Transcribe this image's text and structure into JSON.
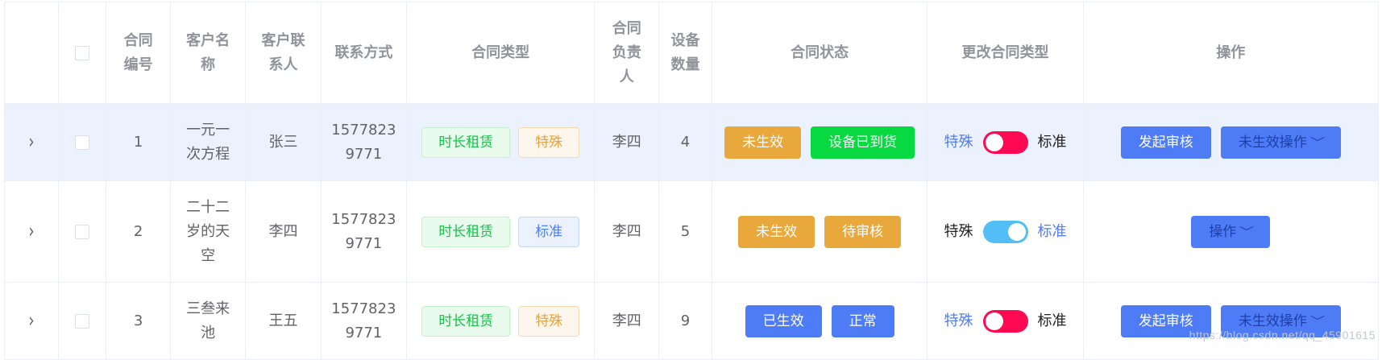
{
  "headers": {
    "contract_no": "合同编号",
    "customer_name": "客户名称",
    "customer_contact": "客户联系人",
    "phone": "联系方式",
    "contract_type": "合同类型",
    "owner": "合同负责人",
    "device_count": "设备数量",
    "contract_status": "合同状态",
    "change_type": "更改合同类型",
    "actions": "操作"
  },
  "rows": [
    {
      "no": "1",
      "customer": "一元一次方程",
      "contact": "张三",
      "phone": "15778239771",
      "type_tag": "时长租赁",
      "sub_tag": "特殊",
      "owner": "李四",
      "devices": "4",
      "status1": "未生效",
      "status2": "设备已到货",
      "switch_left": "特殊",
      "switch_right": "标准",
      "action_btn": "发起审核",
      "dropdown": "未生效操作"
    },
    {
      "no": "2",
      "customer": "二十二岁的天空",
      "contact": "李四",
      "phone": "15778239771",
      "type_tag": "时长租赁",
      "sub_tag": "标准",
      "owner": "李四",
      "devices": "5",
      "status1": "未生效",
      "status2": "待审核",
      "switch_left": "特殊",
      "switch_right": "标准",
      "dropdown": "操作"
    },
    {
      "no": "3",
      "customer": "三叁来池",
      "contact": "王五",
      "phone": "15778239771",
      "type_tag": "时长租赁",
      "sub_tag": "特殊",
      "owner": "李四",
      "devices": "9",
      "status1": "已生效",
      "status2": "正常",
      "switch_left": "特殊",
      "switch_right": "标准",
      "action_btn": "发起审核",
      "dropdown": "未生效操作"
    }
  ],
  "icons": {
    "expand": "chevron-right-icon",
    "dropdown": "chevron-down-icon"
  },
  "colors": {
    "primary": "#4e7cf6",
    "warning": "#e8a83c",
    "success": "#08d940",
    "switch_off": "#ff0a52",
    "switch_on": "#53bdf6",
    "row_highlight": "#ecf2fd"
  },
  "watermark": "https://blog.csdn.net/qq_45901615"
}
